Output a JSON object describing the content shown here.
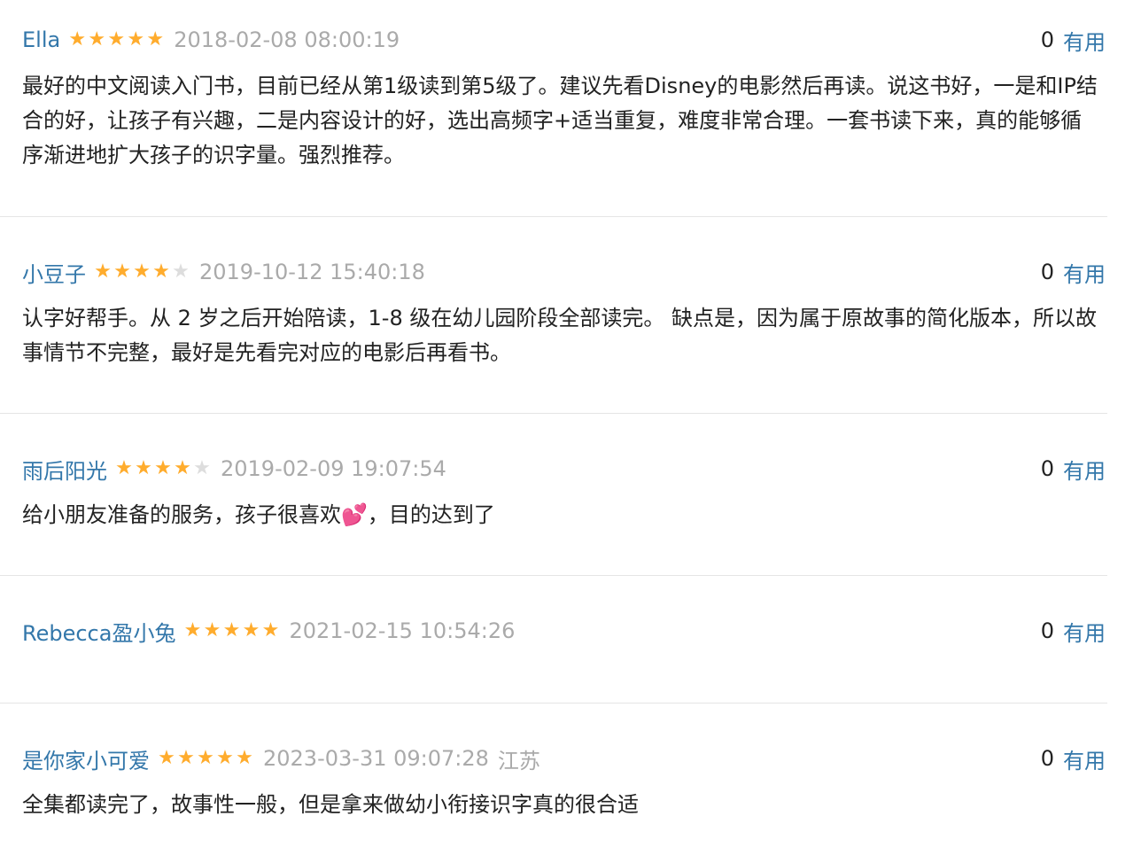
{
  "colors": {
    "link": "#3377aa",
    "star_on": "#ffac2d",
    "star_off": "#dddddd",
    "meta": "#aaaaaa",
    "divider": "#e5e5e5"
  },
  "reviews": [
    {
      "user": "Ella",
      "rating": 5,
      "time": "2018-02-08 08:00:19",
      "location": "",
      "useful_count": "0",
      "useful_label": "有用",
      "text": "最好的中文阅读入门书，目前已经从第1级读到第5级了。建议先看Disney的电影然后再读。说这书好，一是和IP结合的好，让孩子有兴趣，二是内容设计的好，选出高频字+适当重复，难度非常合理。一套书读下来，真的能够循序渐进地扩大孩子的识字量。强烈推荐。"
    },
    {
      "user": "小豆子",
      "rating": 4,
      "time": "2019-10-12 15:40:18",
      "location": "",
      "useful_count": "0",
      "useful_label": "有用",
      "text": "认字好帮手。从 2 岁之后开始陪读，1-8 级在幼儿园阶段全部读完。 缺点是，因为属于原故事的简化版本，所以故事情节不完整，最好是先看完对应的电影后再看书。"
    },
    {
      "user": "雨后阳光",
      "rating": 4,
      "time": "2019-02-09 19:07:54",
      "location": "",
      "useful_count": "0",
      "useful_label": "有用",
      "text": "给小朋友准备的服务，孩子很喜欢",
      "emoji": "💕",
      "text_after": "，目的达到了"
    },
    {
      "user": "Rebecca盈小兔",
      "rating": 5,
      "time": "2021-02-15 10:54:26",
      "location": "",
      "useful_count": "0",
      "useful_label": "有用",
      "text": ""
    },
    {
      "user": "是你家小可爱",
      "rating": 5,
      "time": "2023-03-31 09:07:28",
      "location": "江苏",
      "useful_count": "0",
      "useful_label": "有用",
      "text": "全集都读完了，故事性一般，但是拿来做幼小衔接识字真的很合适"
    }
  ]
}
